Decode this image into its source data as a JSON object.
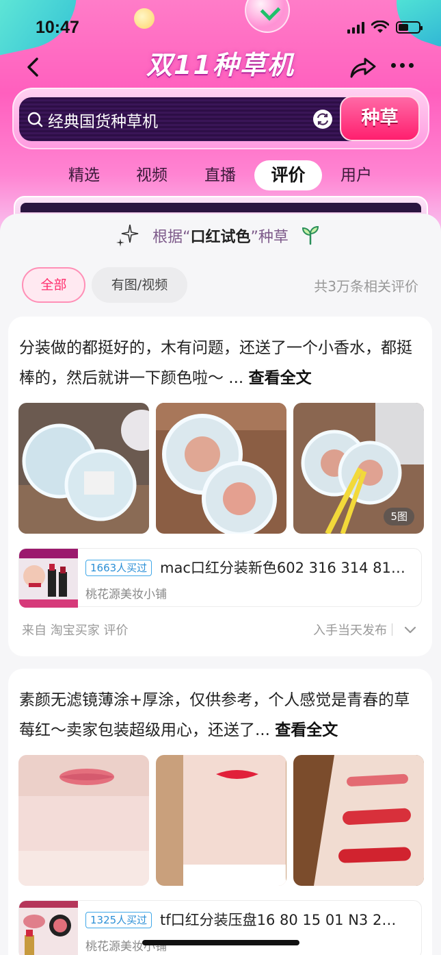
{
  "status_bar": {
    "time": "10:47"
  },
  "nav": {
    "title": "双11种草机"
  },
  "search": {
    "query": "经典国货种草机",
    "button_label": "种草"
  },
  "tabs": [
    {
      "label": "精选"
    },
    {
      "label": "视频"
    },
    {
      "label": "直播"
    },
    {
      "label": "评价",
      "active": true
    },
    {
      "label": "用户"
    }
  ],
  "section": {
    "prefix": "根据“",
    "keyword": "口红试色",
    "suffix": "”种草"
  },
  "filters": {
    "all": "全部",
    "media": "有图/视频",
    "total": "共3万条相关评价"
  },
  "reviews": [
    {
      "text": "分装做的都挺好的，木有问题，还送了一个小香水，都挺棒的，然后就讲一下颜色啦～ ...",
      "more": "查看全文",
      "photo_count": "5图",
      "product": {
        "badge": "1663人买过",
        "title": "mac口红分装新色602 316 314 81…",
        "shop": "桃花源美妆小铺"
      },
      "source": "来自 淘宝买家 评价",
      "time_label": "入手当天发布"
    },
    {
      "text": "素颜无滤镜薄涂+厚涂，仅供参考，个人感觉是青春的草莓红～卖家包装超级用心，还送了...",
      "more": "查看全文",
      "product": {
        "badge": "1325人买过",
        "title": "tf口红分装压盘16 80 15 01 N3 2…",
        "shop": "桃花源美妆小铺"
      }
    }
  ],
  "colors": {
    "accent": "#ff2f6e",
    "header_pink": "#ff5fbe",
    "search_dark": "#2d0e46",
    "badge_blue": "#2b8fd6"
  }
}
